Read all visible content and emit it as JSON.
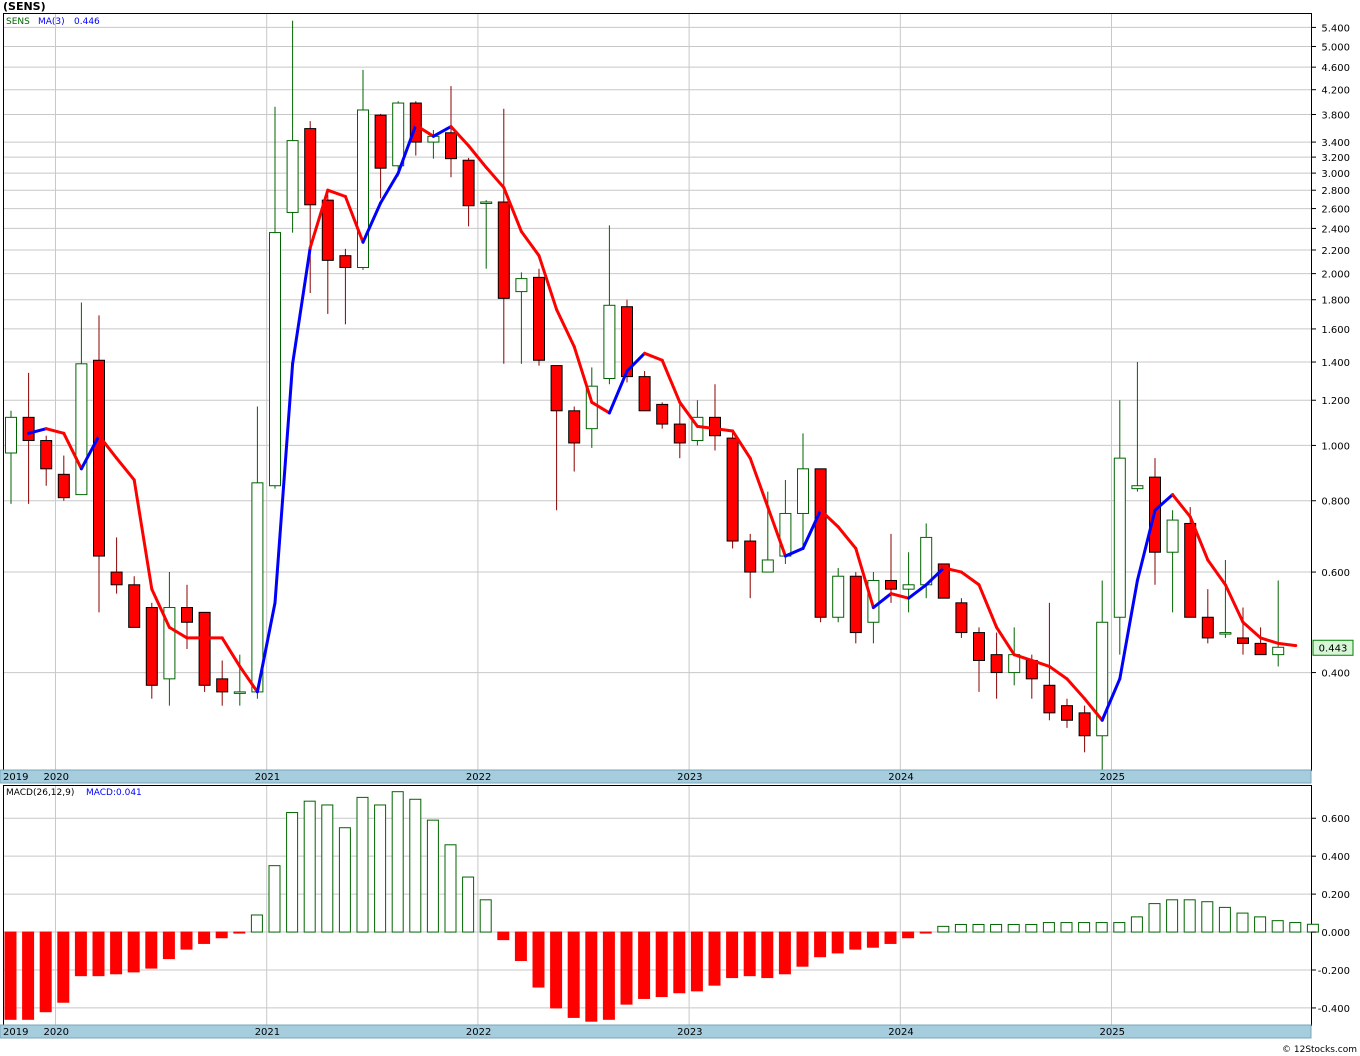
{
  "header": {
    "title": "(SENS)",
    "price_legend_symbol": "SENS",
    "price_legend_ma": "MA(3)",
    "price_legend_ma_value": "0.446",
    "macd_legend": "MACD(26,12,9)",
    "macd_legend_value": "MACD:0.041",
    "copyright": "© 12Stocks.com"
  },
  "colors": {
    "up_candle": "#006400",
    "down_candle": "#ff0000",
    "ma_up": "#0000ff",
    "ma_down": "#ff0000",
    "grid": "#c8c8c8",
    "axis_band": "#a6cddd"
  },
  "chart_data": [
    {
      "type": "candlestick",
      "interval": "monthly",
      "y_scale": "log",
      "ylim": [
        0.27,
        5.7
      ],
      "y_ticks": [
        "5.400",
        "5.000",
        "4.600",
        "4.200",
        "3.800",
        "3.400",
        "3.200",
        "3.000",
        "2.800",
        "2.600",
        "2.400",
        "2.200",
        "2.000",
        "1.800",
        "1.600",
        "1.400",
        "1.200",
        "1.000",
        "0.800",
        "0.600",
        "0.400"
      ],
      "x_labels": [
        "2019",
        "2020",
        "2021",
        "2022",
        "2023",
        "2024",
        "2025"
      ],
      "last_price_label": "0.443",
      "candles": [
        {
          "o": 0.97,
          "h": 1.15,
          "l": 0.79,
          "c": 1.12
        },
        {
          "o": 1.12,
          "h": 1.34,
          "l": 0.79,
          "c": 1.02
        },
        {
          "o": 1.02,
          "h": 1.04,
          "l": 0.85,
          "c": 0.91
        },
        {
          "o": 0.89,
          "h": 0.96,
          "l": 0.8,
          "c": 0.81
        },
        {
          "o": 0.82,
          "h": 1.78,
          "l": 0.82,
          "c": 1.39
        },
        {
          "o": 1.41,
          "h": 1.69,
          "l": 0.51,
          "c": 0.64
        },
        {
          "o": 0.6,
          "h": 0.69,
          "l": 0.55,
          "c": 0.57
        },
        {
          "o": 0.57,
          "h": 0.59,
          "l": 0.48,
          "c": 0.48
        },
        {
          "o": 0.52,
          "h": 0.53,
          "l": 0.36,
          "c": 0.38
        },
        {
          "o": 0.39,
          "h": 0.6,
          "l": 0.35,
          "c": 0.52
        },
        {
          "o": 0.52,
          "h": 0.57,
          "l": 0.44,
          "c": 0.49
        },
        {
          "o": 0.51,
          "h": 0.51,
          "l": 0.37,
          "c": 0.38
        },
        {
          "o": 0.39,
          "h": 0.42,
          "l": 0.35,
          "c": 0.37
        },
        {
          "o": 0.37,
          "h": 0.43,
          "l": 0.35,
          "c": 0.37
        },
        {
          "o": 0.37,
          "h": 1.17,
          "l": 0.36,
          "c": 0.86
        },
        {
          "o": 0.85,
          "h": 3.92,
          "l": 0.84,
          "c": 2.36
        },
        {
          "o": 2.56,
          "h": 5.55,
          "l": 2.36,
          "c": 3.42
        },
        {
          "o": 3.59,
          "h": 3.7,
          "l": 1.85,
          "c": 2.64
        },
        {
          "o": 2.69,
          "h": 2.75,
          "l": 1.7,
          "c": 2.11
        },
        {
          "o": 2.15,
          "h": 2.21,
          "l": 1.63,
          "c": 2.05
        },
        {
          "o": 2.05,
          "h": 4.55,
          "l": 2.03,
          "c": 3.87
        },
        {
          "o": 3.79,
          "h": 3.81,
          "l": 2.71,
          "c": 3.06
        },
        {
          "o": 3.09,
          "h": 4.01,
          "l": 2.96,
          "c": 3.98
        },
        {
          "o": 3.98,
          "h": 4.01,
          "l": 3.22,
          "c": 3.4
        },
        {
          "o": 3.4,
          "h": 3.57,
          "l": 3.18,
          "c": 3.48
        },
        {
          "o": 3.53,
          "h": 4.26,
          "l": 2.95,
          "c": 3.18
        },
        {
          "o": 3.16,
          "h": 3.19,
          "l": 2.42,
          "c": 2.63
        },
        {
          "o": 2.67,
          "h": 2.69,
          "l": 2.04,
          "c": 2.67
        },
        {
          "o": 2.67,
          "h": 3.89,
          "l": 1.39,
          "c": 1.81
        },
        {
          "o": 1.86,
          "h": 2.01,
          "l": 1.39,
          "c": 1.96
        },
        {
          "o": 1.97,
          "h": 2.04,
          "l": 1.38,
          "c": 1.41
        },
        {
          "o": 1.38,
          "h": 1.38,
          "l": 0.77,
          "c": 1.15
        },
        {
          "o": 1.15,
          "h": 1.17,
          "l": 0.9,
          "c": 1.01
        },
        {
          "o": 1.07,
          "h": 1.37,
          "l": 0.99,
          "c": 1.27
        },
        {
          "o": 1.31,
          "h": 2.43,
          "l": 1.28,
          "c": 1.76
        },
        {
          "o": 1.75,
          "h": 1.8,
          "l": 1.29,
          "c": 1.32
        },
        {
          "o": 1.32,
          "h": 1.35,
          "l": 1.15,
          "c": 1.15
        },
        {
          "o": 1.18,
          "h": 1.19,
          "l": 1.07,
          "c": 1.09
        },
        {
          "o": 1.09,
          "h": 1.19,
          "l": 0.95,
          "c": 1.01
        },
        {
          "o": 1.02,
          "h": 1.2,
          "l": 1.0,
          "c": 1.12
        },
        {
          "o": 1.12,
          "h": 1.28,
          "l": 0.98,
          "c": 1.04
        },
        {
          "o": 1.03,
          "h": 1.06,
          "l": 0.66,
          "c": 0.68
        },
        {
          "o": 0.68,
          "h": 0.7,
          "l": 0.54,
          "c": 0.6
        },
        {
          "o": 0.6,
          "h": 0.83,
          "l": 0.6,
          "c": 0.63
        },
        {
          "o": 0.64,
          "h": 0.87,
          "l": 0.62,
          "c": 0.76
        },
        {
          "o": 0.76,
          "h": 1.05,
          "l": 0.66,
          "c": 0.91
        },
        {
          "o": 0.91,
          "h": 0.91,
          "l": 0.49,
          "c": 0.5
        },
        {
          "o": 0.5,
          "h": 0.61,
          "l": 0.49,
          "c": 0.59
        },
        {
          "o": 0.59,
          "h": 0.6,
          "l": 0.45,
          "c": 0.47
        },
        {
          "o": 0.49,
          "h": 0.6,
          "l": 0.45,
          "c": 0.58
        },
        {
          "o": 0.58,
          "h": 0.7,
          "l": 0.53,
          "c": 0.56
        },
        {
          "o": 0.56,
          "h": 0.65,
          "l": 0.51,
          "c": 0.57
        },
        {
          "o": 0.57,
          "h": 0.73,
          "l": 0.54,
          "c": 0.69
        },
        {
          "o": 0.62,
          "h": 0.62,
          "l": 0.54,
          "c": 0.54
        },
        {
          "o": 0.53,
          "h": 0.54,
          "l": 0.46,
          "c": 0.47
        },
        {
          "o": 0.47,
          "h": 0.48,
          "l": 0.37,
          "c": 0.42
        },
        {
          "o": 0.43,
          "h": 0.47,
          "l": 0.36,
          "c": 0.4
        },
        {
          "o": 0.4,
          "h": 0.48,
          "l": 0.38,
          "c": 0.43
        },
        {
          "o": 0.42,
          "h": 0.43,
          "l": 0.36,
          "c": 0.39
        },
        {
          "o": 0.38,
          "h": 0.53,
          "l": 0.33,
          "c": 0.34
        },
        {
          "o": 0.35,
          "h": 0.36,
          "l": 0.32,
          "c": 0.33
        },
        {
          "o": 0.34,
          "h": 0.35,
          "l": 0.29,
          "c": 0.31
        },
        {
          "o": 0.31,
          "h": 0.58,
          "l": 0.27,
          "c": 0.49
        },
        {
          "o": 0.5,
          "h": 1.2,
          "l": 0.43,
          "c": 0.95
        },
        {
          "o": 0.84,
          "h": 1.4,
          "l": 0.83,
          "c": 0.85
        },
        {
          "o": 0.88,
          "h": 0.95,
          "l": 0.57,
          "c": 0.65
        },
        {
          "o": 0.65,
          "h": 0.77,
          "l": 0.51,
          "c": 0.74
        },
        {
          "o": 0.73,
          "h": 0.78,
          "l": 0.5,
          "c": 0.5
        },
        {
          "o": 0.5,
          "h": 0.56,
          "l": 0.45,
          "c": 0.46
        },
        {
          "o": 0.47,
          "h": 0.63,
          "l": 0.46,
          "c": 0.47
        },
        {
          "o": 0.46,
          "h": 0.52,
          "l": 0.43,
          "c": 0.45
        },
        {
          "o": 0.45,
          "h": 0.48,
          "l": 0.43,
          "c": 0.43
        },
        {
          "o": 0.43,
          "h": 0.58,
          "l": 0.41,
          "c": 0.443
        }
      ],
      "ma3": [
        1.05,
        1.07,
        1.05,
        0.91,
        1.04,
        0.95,
        0.87,
        0.56,
        0.48,
        0.46,
        0.46,
        0.46,
        0.41,
        0.37,
        0.53,
        1.39,
        2.22,
        2.8,
        2.73,
        2.27,
        2.66,
        3.0,
        3.64,
        3.48,
        3.62,
        3.35,
        3.07,
        2.83,
        2.37,
        2.15,
        1.73,
        1.49,
        1.19,
        1.14,
        1.35,
        1.45,
        1.41,
        1.19,
        1.08,
        1.07,
        1.06,
        0.95,
        0.78,
        0.64,
        0.66,
        0.77,
        0.72,
        0.66,
        0.52,
        0.55,
        0.54,
        0.57,
        0.61,
        0.6,
        0.57,
        0.48,
        0.43,
        0.42,
        0.41,
        0.39,
        0.36,
        0.33,
        0.39,
        0.58,
        0.77,
        0.82,
        0.75,
        0.63,
        0.57,
        0.49,
        0.46,
        0.45,
        0.446
      ],
      "ma3_trend": [
        "up",
        "up",
        "down",
        "down",
        "up",
        "down",
        "down",
        "down",
        "down",
        "down",
        "down",
        "down",
        "down",
        "down",
        "up",
        "up",
        "up",
        "down",
        "down",
        "down",
        "up",
        "up",
        "up",
        "down",
        "up",
        "down",
        "down",
        "down",
        "down",
        "down",
        "down",
        "down",
        "down",
        "down",
        "up",
        "up",
        "down",
        "down",
        "down",
        "down",
        "down",
        "down",
        "down",
        "down",
        "up",
        "up",
        "down",
        "down",
        "down",
        "up",
        "down",
        "up",
        "up",
        "down",
        "down",
        "down",
        "down",
        "down",
        "down",
        "down",
        "down",
        "down",
        "up",
        "up",
        "up",
        "up",
        "down",
        "down",
        "down",
        "down",
        "down",
        "down",
        "down"
      ]
    },
    {
      "type": "bar",
      "name": "MACD(26,12,9)",
      "ylim": [
        -0.49,
        0.77
      ],
      "y_ticks": [
        "0.600",
        "0.400",
        "0.200",
        "0.000",
        "-0.200",
        "-0.400"
      ],
      "x_labels": [
        "2019",
        "2020",
        "2021",
        "2022",
        "2023",
        "2024",
        "2025"
      ],
      "values": [
        -0.46,
        -0.46,
        -0.42,
        -0.37,
        -0.23,
        -0.23,
        -0.22,
        -0.21,
        -0.19,
        -0.14,
        -0.09,
        -0.06,
        -0.03,
        -0.005,
        0.09,
        0.35,
        0.63,
        0.69,
        0.67,
        0.55,
        0.71,
        0.67,
        0.74,
        0.7,
        0.59,
        0.46,
        0.29,
        0.17,
        -0.04,
        -0.15,
        -0.29,
        -0.4,
        -0.45,
        -0.47,
        -0.46,
        -0.38,
        -0.35,
        -0.34,
        -0.32,
        -0.31,
        -0.28,
        -0.24,
        -0.23,
        -0.24,
        -0.22,
        -0.18,
        -0.13,
        -0.11,
        -0.09,
        -0.08,
        -0.06,
        -0.03,
        -0.005,
        0.03,
        0.04,
        0.04,
        0.04,
        0.04,
        0.04,
        0.05,
        0.05,
        0.05,
        0.05,
        0.05,
        0.08,
        0.15,
        0.17,
        0.17,
        0.16,
        0.13,
        0.1,
        0.08,
        0.06,
        0.05,
        0.041
      ]
    }
  ]
}
